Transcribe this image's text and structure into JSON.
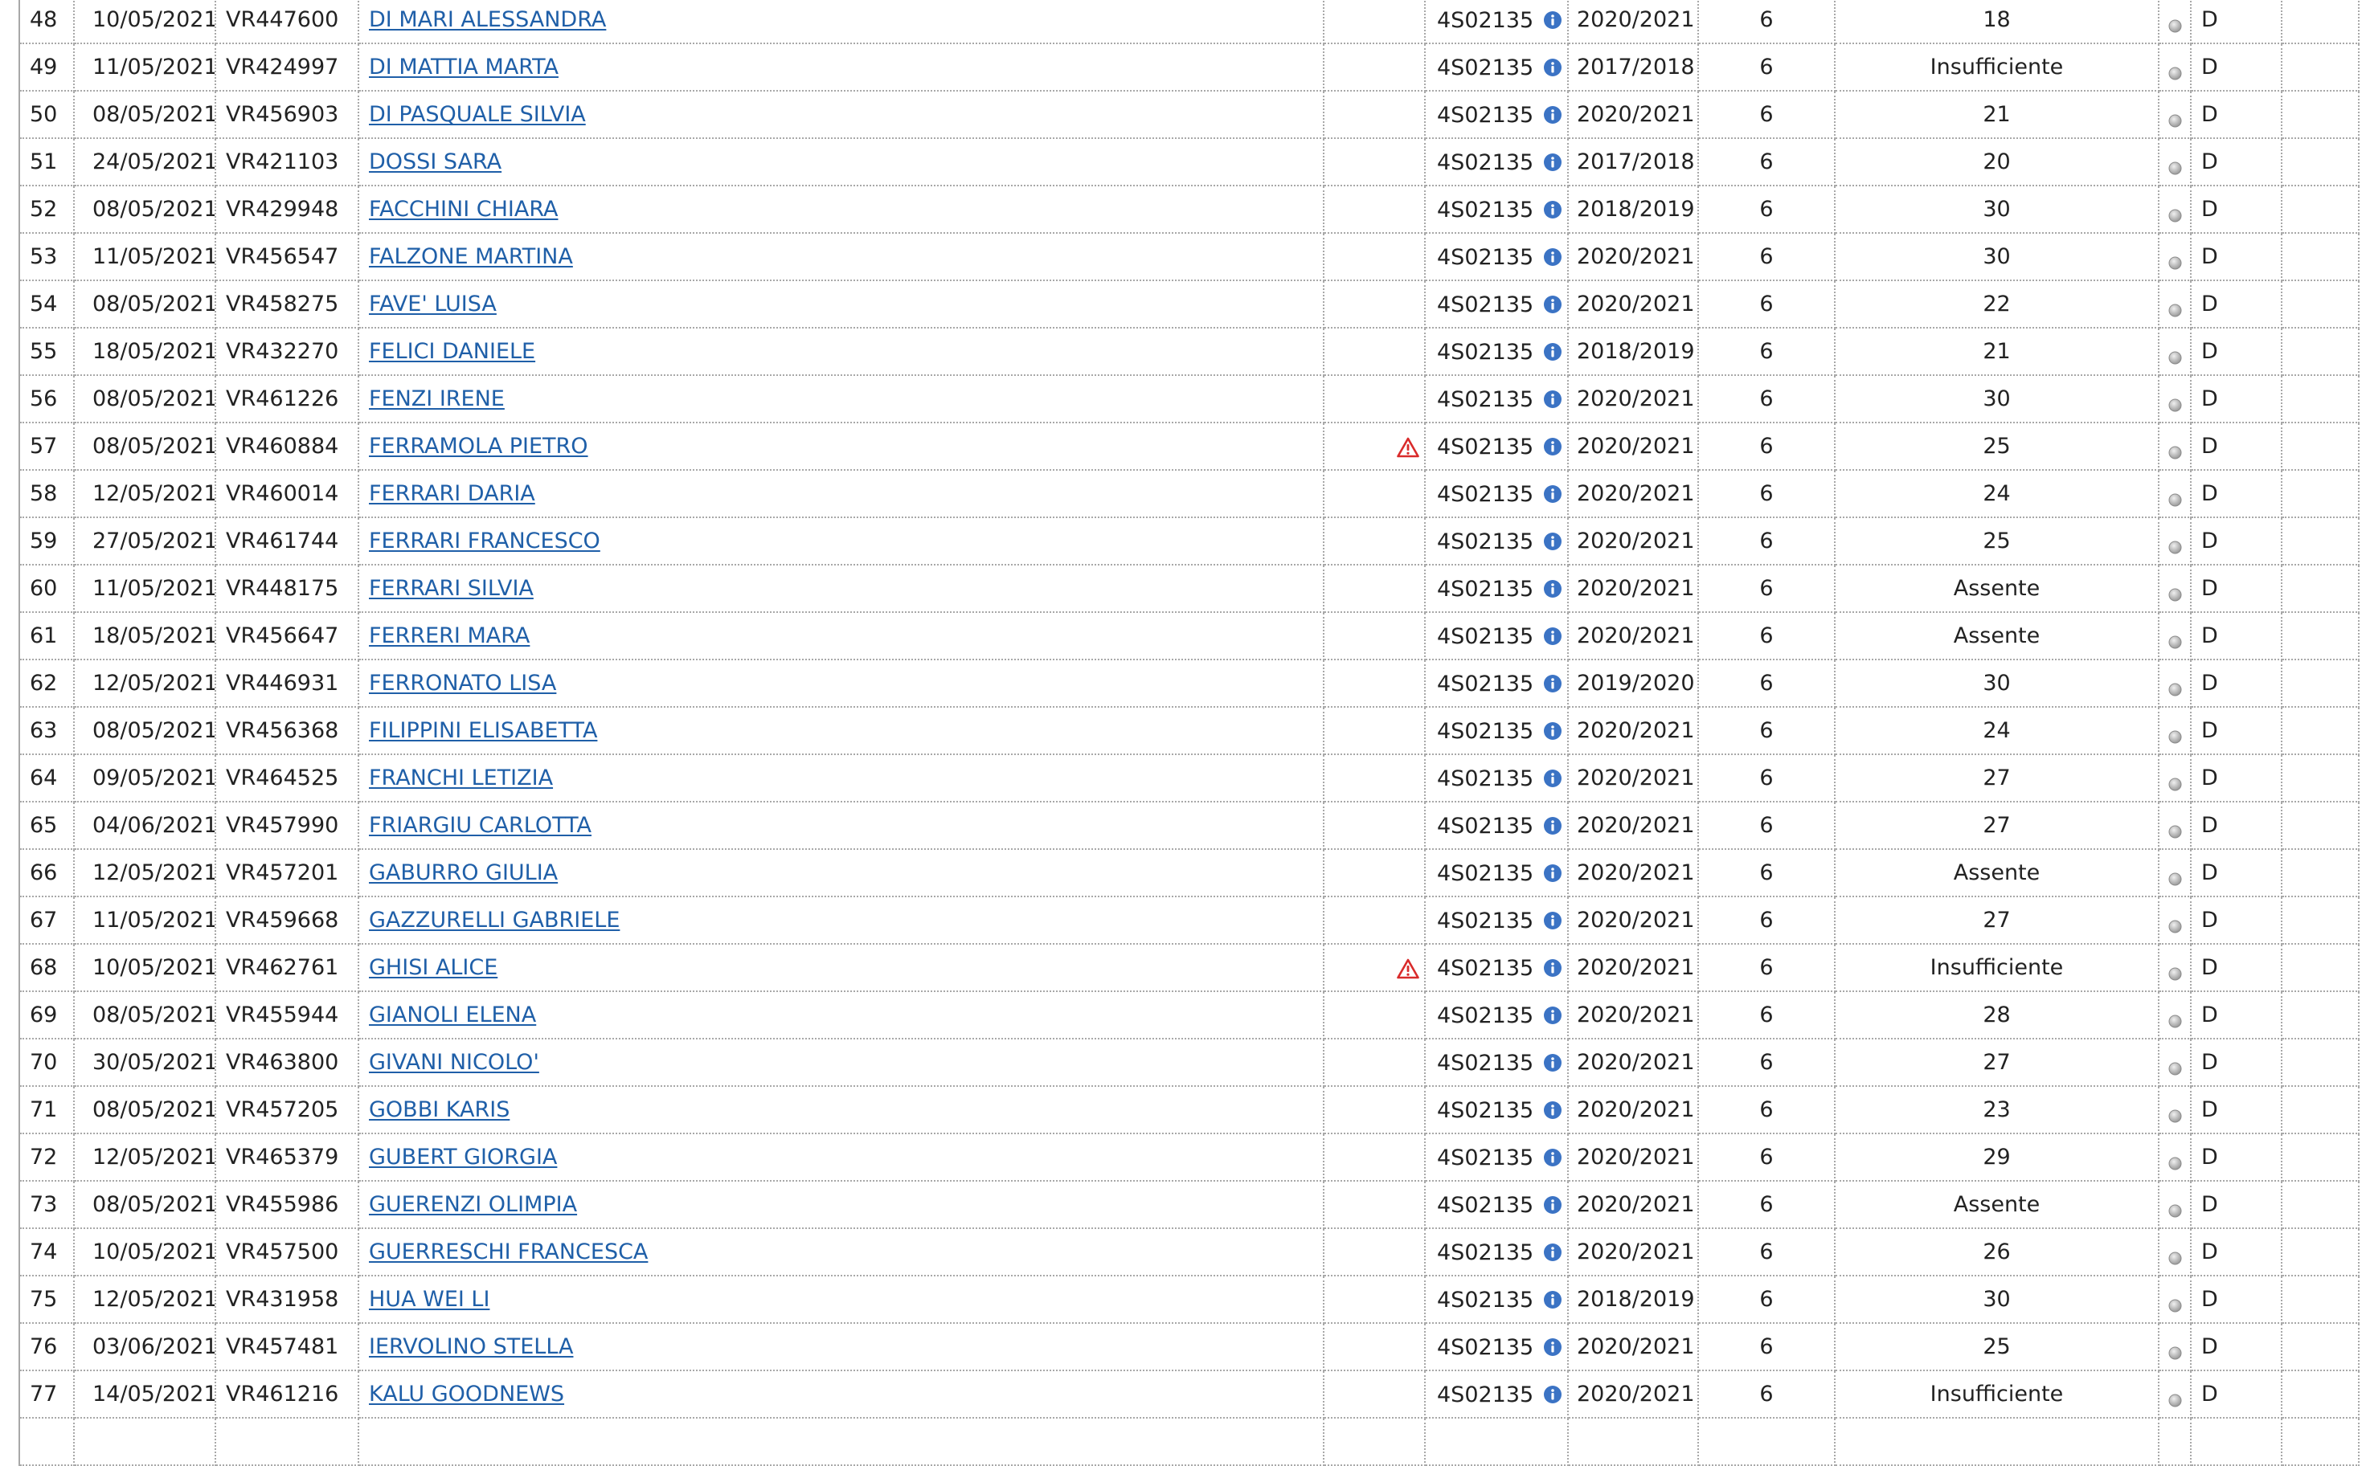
{
  "table": {
    "rows": [
      {
        "num": "48",
        "date": "10/05/2021",
        "matricola": "VR447600",
        "name": "DI MARI ALESSANDRA",
        "warning": false,
        "course_code": "4S02135",
        "academic_year": "2020/2021",
        "cfu": "6",
        "grade": "18",
        "outcome": "D"
      },
      {
        "num": "49",
        "date": "11/05/2021",
        "matricola": "VR424997",
        "name": "DI MATTIA MARTA",
        "warning": false,
        "course_code": "4S02135",
        "academic_year": "2017/2018",
        "cfu": "6",
        "grade": "Insufficiente",
        "outcome": "D"
      },
      {
        "num": "50",
        "date": "08/05/2021",
        "matricola": "VR456903",
        "name": "DI PASQUALE SILVIA",
        "warning": false,
        "course_code": "4S02135",
        "academic_year": "2020/2021",
        "cfu": "6",
        "grade": "21",
        "outcome": "D"
      },
      {
        "num": "51",
        "date": "24/05/2021",
        "matricola": "VR421103",
        "name": "DOSSI SARA",
        "warning": false,
        "course_code": "4S02135",
        "academic_year": "2017/2018",
        "cfu": "6",
        "grade": "20",
        "outcome": "D"
      },
      {
        "num": "52",
        "date": "08/05/2021",
        "matricola": "VR429948",
        "name": "FACCHINI CHIARA",
        "warning": false,
        "course_code": "4S02135",
        "academic_year": "2018/2019",
        "cfu": "6",
        "grade": "30",
        "outcome": "D"
      },
      {
        "num": "53",
        "date": "11/05/2021",
        "matricola": "VR456547",
        "name": "FALZONE MARTINA",
        "warning": false,
        "course_code": "4S02135",
        "academic_year": "2020/2021",
        "cfu": "6",
        "grade": "30",
        "outcome": "D"
      },
      {
        "num": "54",
        "date": "08/05/2021",
        "matricola": "VR458275",
        "name": "FAVE' LUISA",
        "warning": false,
        "course_code": "4S02135",
        "academic_year": "2020/2021",
        "cfu": "6",
        "grade": "22",
        "outcome": "D"
      },
      {
        "num": "55",
        "date": "18/05/2021",
        "matricola": "VR432270",
        "name": "FELICI DANIELE",
        "warning": false,
        "course_code": "4S02135",
        "academic_year": "2018/2019",
        "cfu": "6",
        "grade": "21",
        "outcome": "D"
      },
      {
        "num": "56",
        "date": "08/05/2021",
        "matricola": "VR461226",
        "name": "FENZI IRENE",
        "warning": false,
        "course_code": "4S02135",
        "academic_year": "2020/2021",
        "cfu": "6",
        "grade": "30",
        "outcome": "D"
      },
      {
        "num": "57",
        "date": "08/05/2021",
        "matricola": "VR460884",
        "name": "FERRAMOLA PIETRO",
        "warning": true,
        "course_code": "4S02135",
        "academic_year": "2020/2021",
        "cfu": "6",
        "grade": "25",
        "outcome": "D"
      },
      {
        "num": "58",
        "date": "12/05/2021",
        "matricola": "VR460014",
        "name": "FERRARI DARIA",
        "warning": false,
        "course_code": "4S02135",
        "academic_year": "2020/2021",
        "cfu": "6",
        "grade": "24",
        "outcome": "D"
      },
      {
        "num": "59",
        "date": "27/05/2021",
        "matricola": "VR461744",
        "name": "FERRARI FRANCESCO",
        "warning": false,
        "course_code": "4S02135",
        "academic_year": "2020/2021",
        "cfu": "6",
        "grade": "25",
        "outcome": "D"
      },
      {
        "num": "60",
        "date": "11/05/2021",
        "matricola": "VR448175",
        "name": "FERRARI SILVIA",
        "warning": false,
        "course_code": "4S02135",
        "academic_year": "2020/2021",
        "cfu": "6",
        "grade": "Assente",
        "outcome": "D"
      },
      {
        "num": "61",
        "date": "18/05/2021",
        "matricola": "VR456647",
        "name": "FERRERI MARA",
        "warning": false,
        "course_code": "4S02135",
        "academic_year": "2020/2021",
        "cfu": "6",
        "grade": "Assente",
        "outcome": "D"
      },
      {
        "num": "62",
        "date": "12/05/2021",
        "matricola": "VR446931",
        "name": "FERRONATO LISA",
        "warning": false,
        "course_code": "4S02135",
        "academic_year": "2019/2020",
        "cfu": "6",
        "grade": "30",
        "outcome": "D"
      },
      {
        "num": "63",
        "date": "08/05/2021",
        "matricola": "VR456368",
        "name": "FILIPPINI ELISABETTA",
        "warning": false,
        "course_code": "4S02135",
        "academic_year": "2020/2021",
        "cfu": "6",
        "grade": "24",
        "outcome": "D"
      },
      {
        "num": "64",
        "date": "09/05/2021",
        "matricola": "VR464525",
        "name": "FRANCHI LETIZIA",
        "warning": false,
        "course_code": "4S02135",
        "academic_year": "2020/2021",
        "cfu": "6",
        "grade": "27",
        "outcome": "D"
      },
      {
        "num": "65",
        "date": "04/06/2021",
        "matricola": "VR457990",
        "name": "FRIARGIU CARLOTTA",
        "warning": false,
        "course_code": "4S02135",
        "academic_year": "2020/2021",
        "cfu": "6",
        "grade": "27",
        "outcome": "D"
      },
      {
        "num": "66",
        "date": "12/05/2021",
        "matricola": "VR457201",
        "name": "GABURRO GIULIA",
        "warning": false,
        "course_code": "4S02135",
        "academic_year": "2020/2021",
        "cfu": "6",
        "grade": "Assente",
        "outcome": "D"
      },
      {
        "num": "67",
        "date": "11/05/2021",
        "matricola": "VR459668",
        "name": "GAZZURELLI GABRIELE",
        "warning": false,
        "course_code": "4S02135",
        "academic_year": "2020/2021",
        "cfu": "6",
        "grade": "27",
        "outcome": "D"
      },
      {
        "num": "68",
        "date": "10/05/2021",
        "matricola": "VR462761",
        "name": "GHISI ALICE",
        "warning": true,
        "course_code": "4S02135",
        "academic_year": "2020/2021",
        "cfu": "6",
        "grade": "Insufficiente",
        "outcome": "D"
      },
      {
        "num": "69",
        "date": "08/05/2021",
        "matricola": "VR455944",
        "name": "GIANOLI ELENA",
        "warning": false,
        "course_code": "4S02135",
        "academic_year": "2020/2021",
        "cfu": "6",
        "grade": "28",
        "outcome": "D"
      },
      {
        "num": "70",
        "date": "30/05/2021",
        "matricola": "VR463800",
        "name": "GIVANI NICOLO'",
        "warning": false,
        "course_code": "4S02135",
        "academic_year": "2020/2021",
        "cfu": "6",
        "grade": "27",
        "outcome": "D"
      },
      {
        "num": "71",
        "date": "08/05/2021",
        "matricola": "VR457205",
        "name": "GOBBI KARIS",
        "warning": false,
        "course_code": "4S02135",
        "academic_year": "2020/2021",
        "cfu": "6",
        "grade": "23",
        "outcome": "D"
      },
      {
        "num": "72",
        "date": "12/05/2021",
        "matricola": "VR465379",
        "name": "GUBERT GIORGIA",
        "warning": false,
        "course_code": "4S02135",
        "academic_year": "2020/2021",
        "cfu": "6",
        "grade": "29",
        "outcome": "D"
      },
      {
        "num": "73",
        "date": "08/05/2021",
        "matricola": "VR455986",
        "name": "GUERENZI OLIMPIA",
        "warning": false,
        "course_code": "4S02135",
        "academic_year": "2020/2021",
        "cfu": "6",
        "grade": "Assente",
        "outcome": "D"
      },
      {
        "num": "74",
        "date": "10/05/2021",
        "matricola": "VR457500",
        "name": "GUERRESCHI FRANCESCA",
        "warning": false,
        "course_code": "4S02135",
        "academic_year": "2020/2021",
        "cfu": "6",
        "grade": "26",
        "outcome": "D"
      },
      {
        "num": "75",
        "date": "12/05/2021",
        "matricola": "VR431958",
        "name": "HUA WEI LI",
        "warning": false,
        "course_code": "4S02135",
        "academic_year": "2018/2019",
        "cfu": "6",
        "grade": "30",
        "outcome": "D"
      },
      {
        "num": "76",
        "date": "03/06/2021",
        "matricola": "VR457481",
        "name": "IERVOLINO STELLA",
        "warning": false,
        "course_code": "4S02135",
        "academic_year": "2020/2021",
        "cfu": "6",
        "grade": "25",
        "outcome": "D"
      },
      {
        "num": "77",
        "date": "14/05/2021",
        "matricola": "VR461216",
        "name": "KALU GOODNEWS",
        "warning": false,
        "course_code": "4S02135",
        "academic_year": "2020/2021",
        "cfu": "6",
        "grade": "Insufficiente",
        "outcome": "D"
      },
      {
        "num": "",
        "date": "",
        "matricola": "",
        "name": "",
        "warning": false,
        "course_code": "",
        "academic_year": "",
        "cfu": "",
        "grade": "",
        "outcome": ""
      }
    ]
  },
  "icons": {
    "info": "info-icon",
    "warning": "warning-icon",
    "status": "status-icon"
  },
  "colors": {
    "link": "#1f5fa8",
    "info_icon": "#3b73c4",
    "warning_icon": "#d92b2b",
    "status_icon": "#9a9a9a",
    "grid": "#a8a8a8",
    "text": "#222222"
  }
}
